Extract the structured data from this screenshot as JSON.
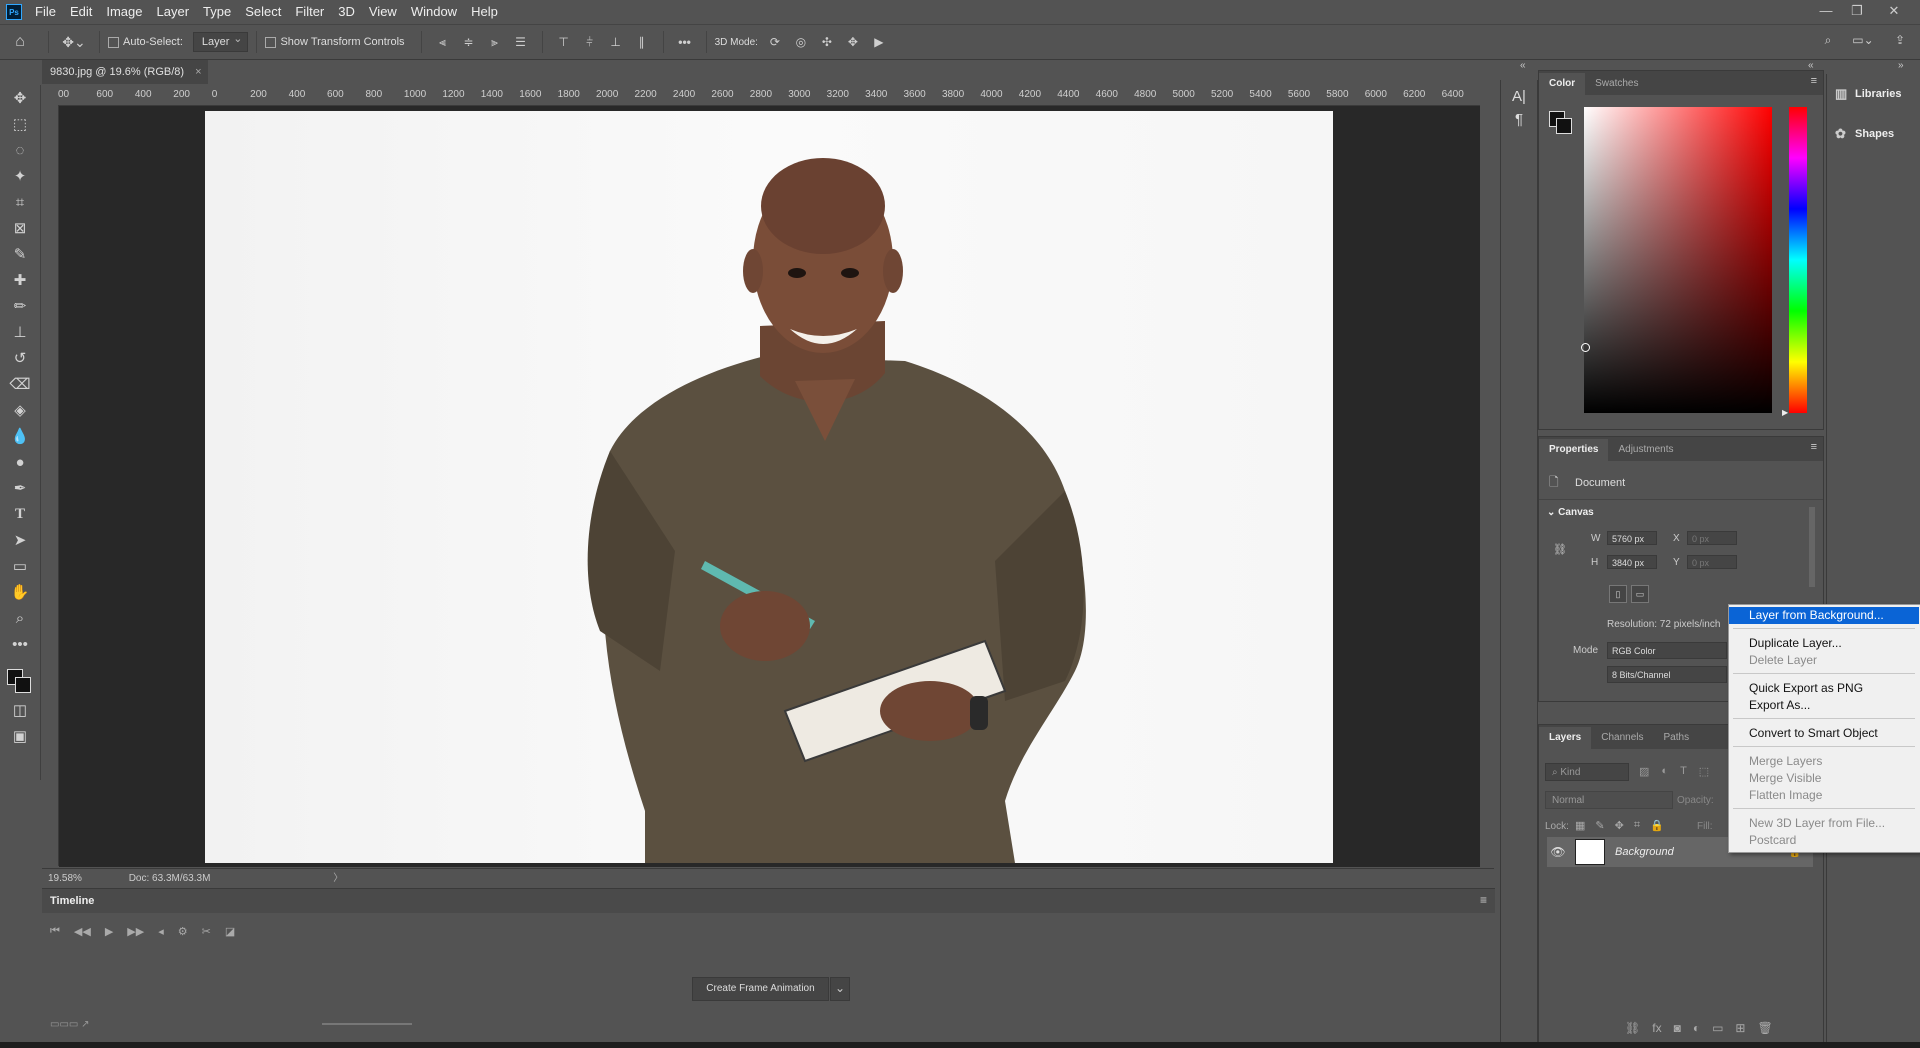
{
  "app": {
    "logo": "Ps"
  },
  "menubar": {
    "items": [
      "File",
      "Edit",
      "Image",
      "Layer",
      "Type",
      "Select",
      "Filter",
      "3D",
      "View",
      "Window",
      "Help"
    ],
    "min_icon": "minimize-icon",
    "restore_icon": "restore-icon",
    "close_icon": "close-icon"
  },
  "optionsbar": {
    "auto_select_label": "Auto-Select:",
    "auto_select_value": "Layer",
    "show_transform_label": "Show Transform Controls",
    "more": "•••",
    "mode_3d_label": "3D Mode:"
  },
  "document": {
    "tab_title": "9830.jpg @ 19.6% (RGB/8)",
    "tab_close": "×",
    "zoom": "19.58%",
    "doc_info": "Doc: 63.3M/63.3M",
    "ruler_ticks": [
      "00",
      "600",
      "400",
      "200",
      "0",
      "200",
      "400",
      "600",
      "800",
      "1000",
      "1200",
      "1400",
      "1600",
      "1800",
      "2000",
      "2200",
      "2400",
      "2600",
      "2800",
      "3000",
      "3200",
      "3400",
      "3600",
      "3800",
      "4000",
      "4200",
      "4400",
      "4600",
      "4800",
      "5000",
      "5200",
      "5400",
      "5600",
      "5800",
      "6000",
      "6200",
      "6400"
    ]
  },
  "timeline": {
    "title": "Timeline",
    "create_button": "Create Frame Animation"
  },
  "color_panel": {
    "tabs": [
      "Color",
      "Swatches"
    ]
  },
  "properties_panel": {
    "tabs": [
      "Properties",
      "Adjustments"
    ],
    "doc_label": "Document",
    "canvas_label": "Canvas",
    "w_label": "W",
    "w_value": "5760 px",
    "h_label": "H",
    "h_value": "3840 px",
    "x_label": "X",
    "x_value": "0 px",
    "y_label": "Y",
    "y_value": "0 px",
    "resolution": "Resolution: 72 pixels/inch",
    "mode_label": "Mode",
    "mode_value": "RGB Color",
    "bits_value": "8 Bits/Channel"
  },
  "layers_panel": {
    "tabs": [
      "Layers",
      "Channels",
      "Paths"
    ],
    "kind_placeholder": "Kind",
    "blend_mode": "Normal",
    "opacity_label": "Opacity:",
    "lock_label": "Lock:",
    "fill_label": "Fill:",
    "layer_name": "Background"
  },
  "libraries": {
    "items": [
      "Libraries",
      "Shapes"
    ]
  },
  "context_menu": {
    "items": [
      {
        "label": "Layer from Background...",
        "state": "highlighted"
      },
      {
        "label": "Duplicate Layer...",
        "state": "enabled"
      },
      {
        "label": "Delete Layer",
        "state": "disabled"
      },
      {
        "label": "Quick Export as PNG",
        "state": "enabled"
      },
      {
        "label": "Export As...",
        "state": "enabled"
      },
      {
        "label": "Convert to Smart Object",
        "state": "enabled"
      },
      {
        "label": "Merge Layers",
        "state": "disabled"
      },
      {
        "label": "Merge Visible",
        "state": "disabled"
      },
      {
        "label": "Flatten Image",
        "state": "disabled"
      },
      {
        "label": "New 3D Layer from File...",
        "state": "disabled"
      },
      {
        "label": "Postcard",
        "state": "disabled"
      }
    ]
  },
  "colors": {
    "accent": "#0a64d6",
    "panel_bg": "#535353",
    "canvas_bg": "#282828",
    "shirt": "#5b5040"
  }
}
